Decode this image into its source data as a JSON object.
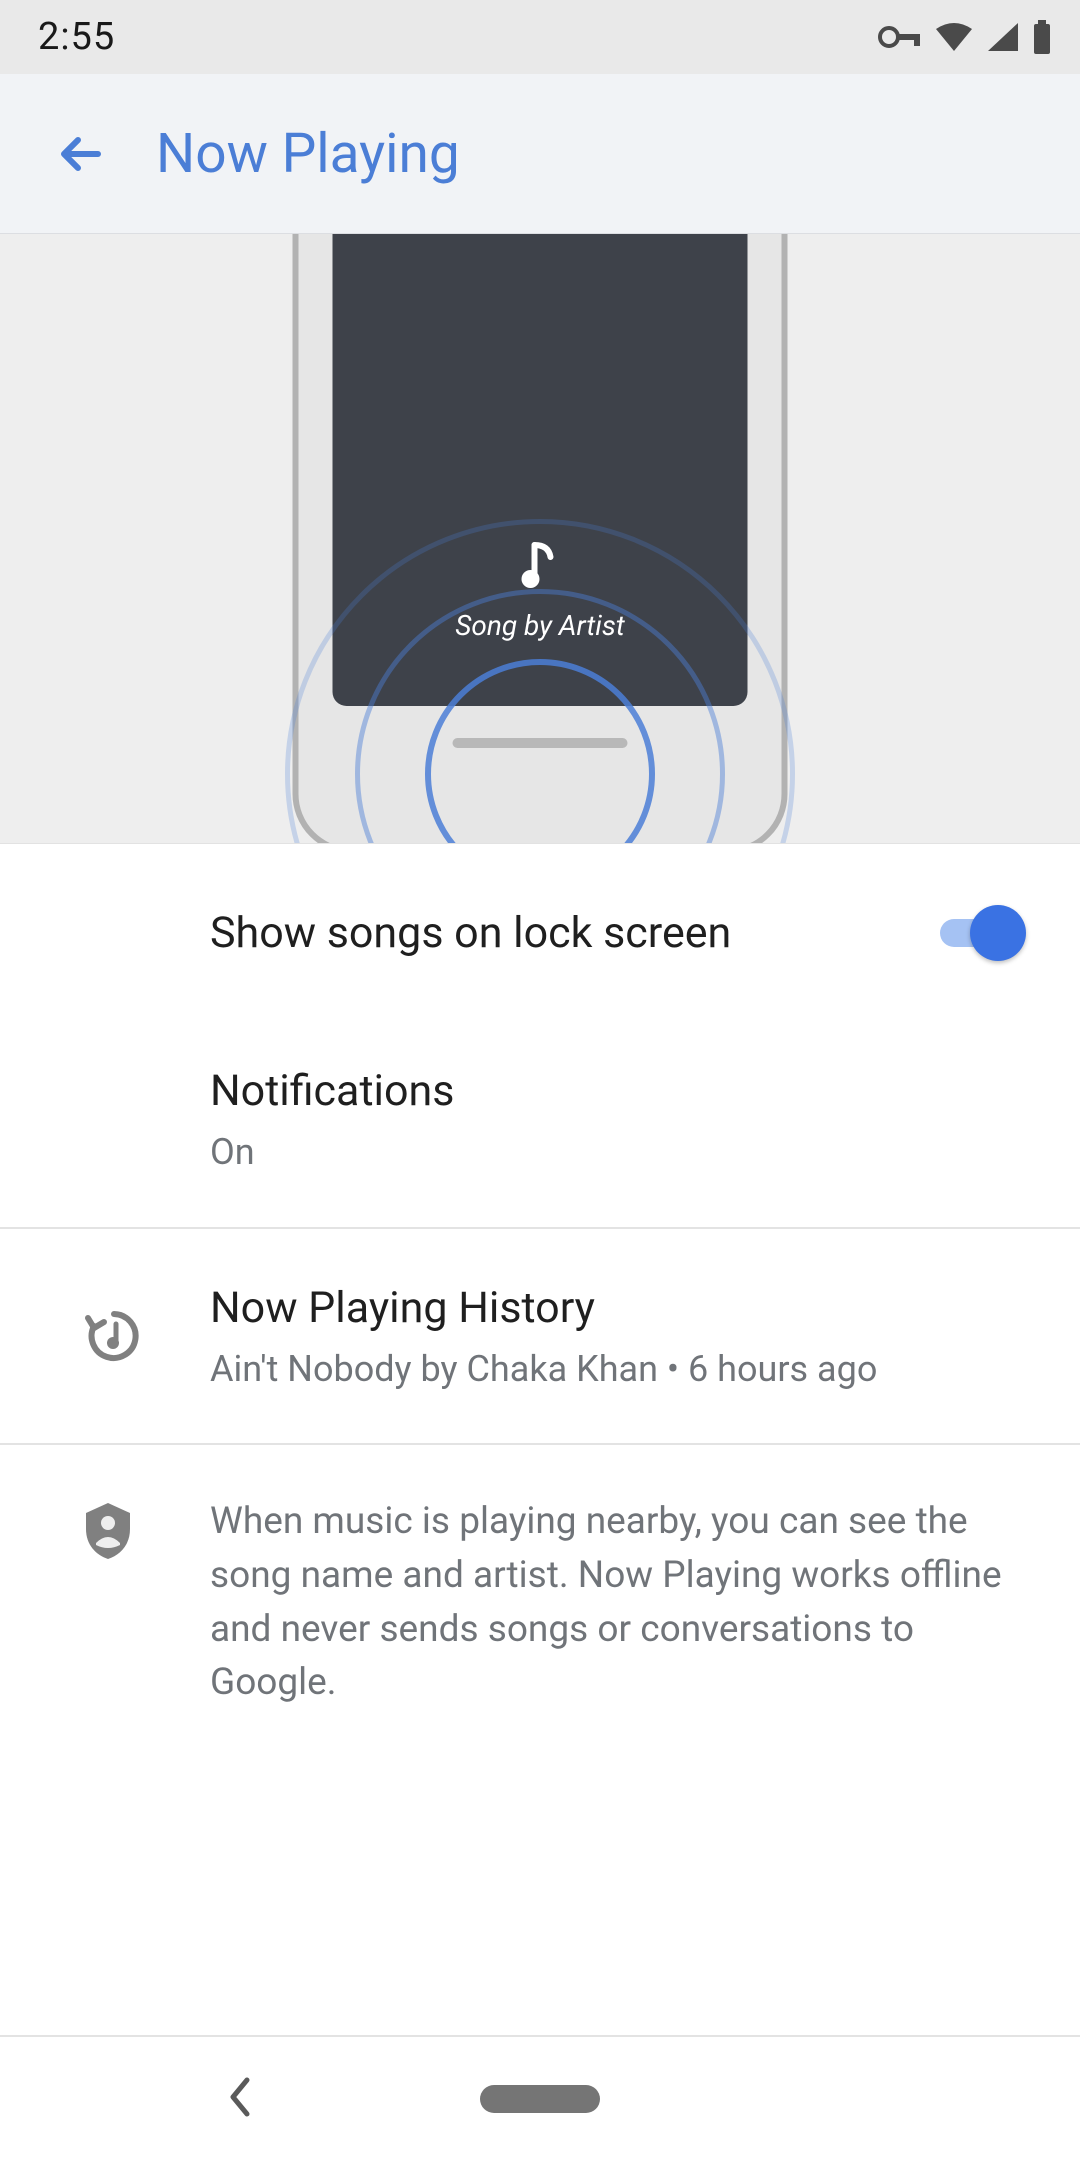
{
  "status": {
    "time": "2:55"
  },
  "appbar": {
    "title": "Now Playing"
  },
  "hero": {
    "song_label": "Song by Artist"
  },
  "settings": {
    "lockscreen": {
      "title": "Show songs on lock screen",
      "enabled": true
    },
    "notifications": {
      "title": "Notifications",
      "value": "On"
    },
    "history": {
      "title": "Now Playing History",
      "subtitle": "Ain't Nobody by Chaka Khan • 6 hours ago"
    },
    "info": {
      "text": "When music is playing nearby, you can see the song name and artist. Now Playing works offline and never sends songs or conversations to Google."
    }
  }
}
